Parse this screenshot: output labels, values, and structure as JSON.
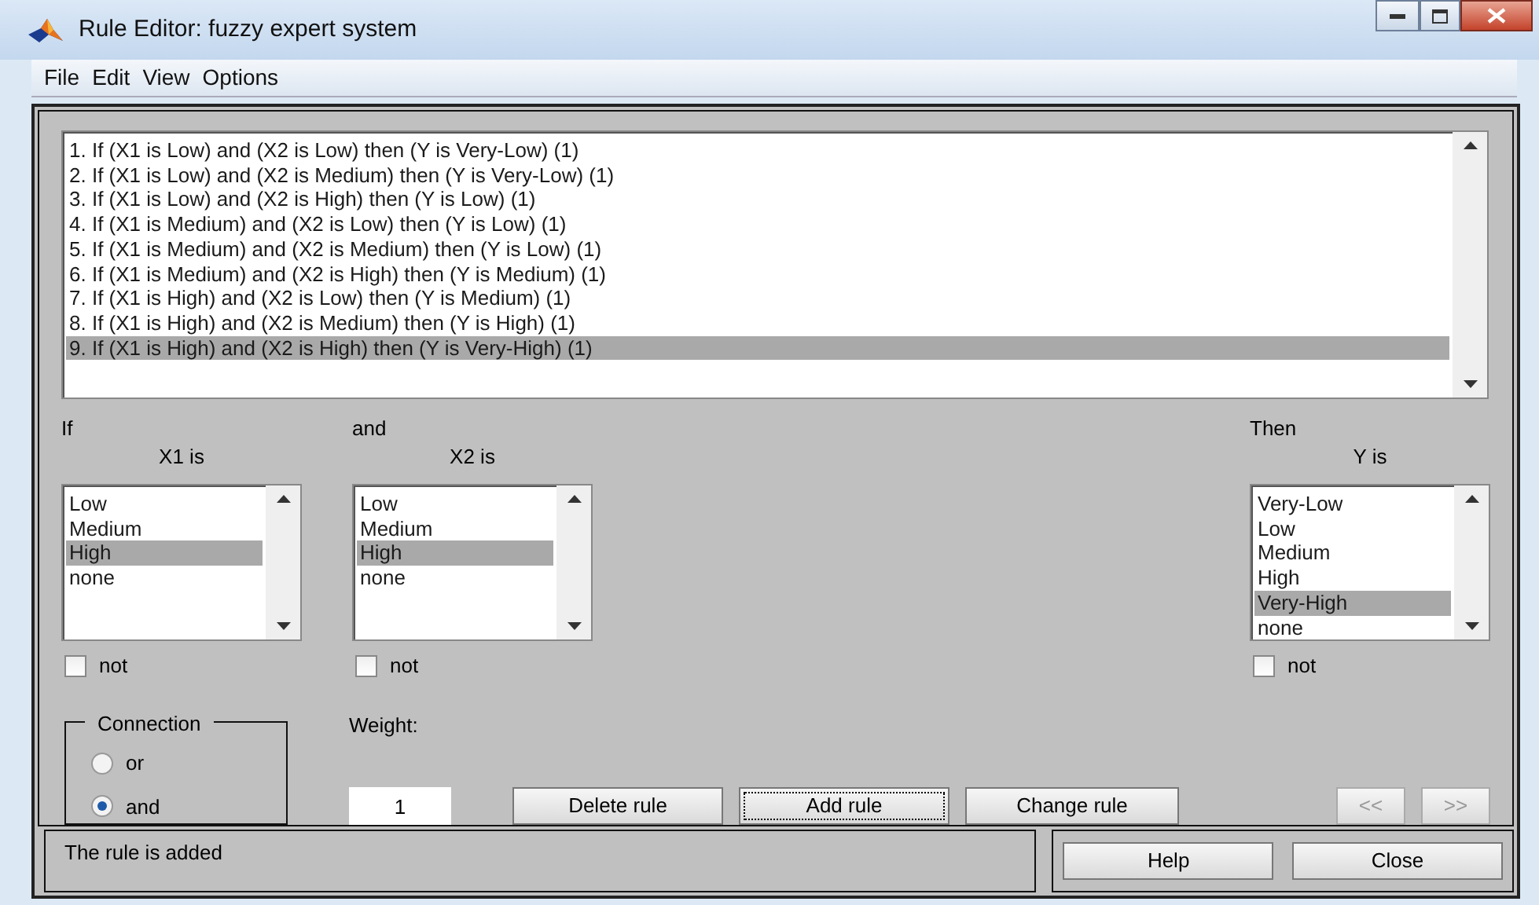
{
  "window": {
    "title": "Rule Editor: fuzzy expert system"
  },
  "menu": [
    "File",
    "Edit",
    "View",
    "Options"
  ],
  "rules": [
    {
      "text": "1. If (X1 is Low) and (X2 is Low) then (Y is Very-Low) (1)",
      "selected": false
    },
    {
      "text": "2. If (X1 is Low) and (X2 is Medium) then (Y is Very-Low) (1)",
      "selected": false
    },
    {
      "text": "3. If (X1 is Low) and (X2 is High) then (Y is Low) (1)",
      "selected": false
    },
    {
      "text": "4. If (X1 is Medium) and (X2 is Low) then (Y is Low) (1)",
      "selected": false
    },
    {
      "text": "5. If (X1 is Medium) and (X2 is Medium) then (Y is Low) (1)",
      "selected": false
    },
    {
      "text": "6. If (X1 is Medium) and (X2 is High) then (Y is Medium) (1)",
      "selected": false
    },
    {
      "text": "7. If (X1 is High) and (X2 is Low) then (Y is Medium) (1)",
      "selected": false
    },
    {
      "text": "8. If (X1 is High) and (X2 is Medium) then (Y is High) (1)",
      "selected": false
    },
    {
      "text": "9. If (X1 is High) and (X2 is High) then (Y is Very-High) (1)",
      "selected": true
    }
  ],
  "variables": [
    {
      "kind": "input",
      "header": "If",
      "label": "X1 is",
      "options": [
        {
          "text": "Low",
          "selected": false
        },
        {
          "text": "Medium",
          "selected": false
        },
        {
          "text": "High",
          "selected": true
        },
        {
          "text": "none",
          "selected": false
        }
      ],
      "negate": {
        "label": "not",
        "checked": false
      }
    },
    {
      "kind": "input",
      "header": "and",
      "label": "X2 is",
      "options": [
        {
          "text": "Low",
          "selected": false
        },
        {
          "text": "Medium",
          "selected": false
        },
        {
          "text": "High",
          "selected": true
        },
        {
          "text": "none",
          "selected": false
        }
      ],
      "negate": {
        "label": "not",
        "checked": false
      }
    },
    {
      "kind": "output",
      "header": "Then",
      "label": "Y is",
      "options": [
        {
          "text": "Very-Low",
          "selected": false
        },
        {
          "text": "Low",
          "selected": false
        },
        {
          "text": "Medium",
          "selected": false
        },
        {
          "text": "High",
          "selected": false
        },
        {
          "text": "Very-High",
          "selected": true
        },
        {
          "text": "none",
          "selected": false
        }
      ],
      "negate": {
        "label": "not",
        "checked": false
      }
    }
  ],
  "connection": {
    "title": "Connection",
    "options": [
      {
        "label": "or",
        "selected": false
      },
      {
        "label": "and",
        "selected": true
      }
    ]
  },
  "weight": {
    "label": "Weight:",
    "value": "1"
  },
  "buttons": [
    {
      "kind": "action",
      "label": "Delete rule",
      "focused": false,
      "disabled": false
    },
    {
      "kind": "action",
      "label": "Add rule",
      "focused": true,
      "disabled": false
    },
    {
      "kind": "action",
      "label": "Change rule",
      "focused": false,
      "disabled": false
    },
    {
      "kind": "nav",
      "label": "<<",
      "focused": false,
      "disabled": true
    },
    {
      "kind": "nav",
      "label": ">>",
      "focused": false,
      "disabled": true
    }
  ],
  "status": "The rule is added",
  "footer_buttons": [
    "Help",
    "Close"
  ]
}
